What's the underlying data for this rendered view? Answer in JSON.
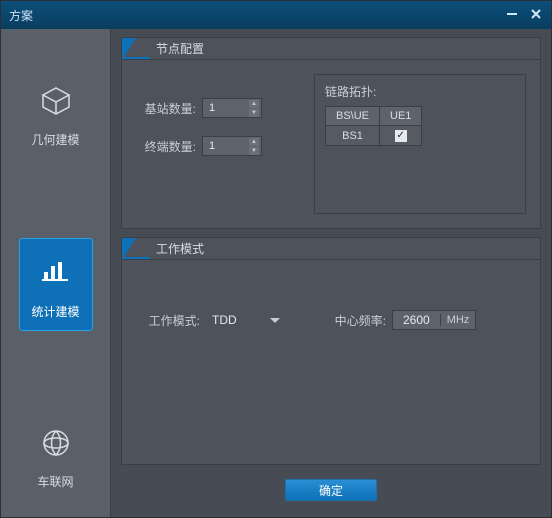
{
  "window": {
    "title": "方案"
  },
  "sidebar": {
    "items": [
      {
        "label": "几何建模"
      },
      {
        "label": "统计建模"
      },
      {
        "label": "车联网"
      }
    ]
  },
  "sections": {
    "node": {
      "title": "节点配置",
      "bs_count_label": "基站数量:",
      "bs_count_value": "1",
      "ue_count_label": "终端数量:",
      "ue_count_value": "1",
      "link_title": "链路拓扑:",
      "table": {
        "corner": "BS\\UE",
        "col": "UE1",
        "row": "BS1",
        "checked": true
      }
    },
    "mode": {
      "title": "工作模式",
      "work_mode_label": "工作模式:",
      "work_mode_value": "TDD",
      "center_freq_label": "中心频率:",
      "center_freq_value": "2600",
      "center_freq_unit": "MHz"
    }
  },
  "footer": {
    "ok": "确定"
  }
}
